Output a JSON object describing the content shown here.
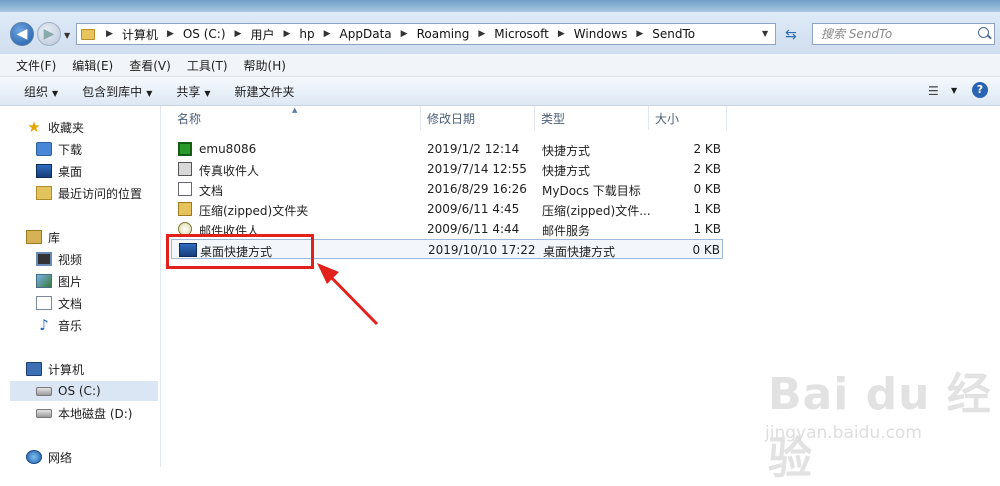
{
  "address": {
    "crumbs": [
      "计算机",
      "OS (C:)",
      "用户",
      "hp",
      "AppData",
      "Roaming",
      "Microsoft",
      "Windows",
      "SendTo"
    ],
    "search_placeholder": "搜索 SendTo"
  },
  "menu": [
    "文件(F)",
    "编辑(E)",
    "查看(V)",
    "工具(T)",
    "帮助(H)"
  ],
  "toolbar": {
    "organize": "组织",
    "include_library": "包含到库中",
    "share": "共享",
    "new_folder": "新建文件夹"
  },
  "sidebar": {
    "favorites": "收藏夹",
    "downloads": "下载",
    "desktop": "桌面",
    "recent": "最近访问的位置",
    "library": "库",
    "videos": "视频",
    "pictures": "图片",
    "documents": "文档",
    "music": "音乐",
    "computer": "计算机",
    "drive_c": "OS (C:)",
    "drive_d": "本地磁盘 (D:)",
    "network": "网络"
  },
  "columns": {
    "name": "名称",
    "date": "修改日期",
    "type": "类型",
    "size": "大小"
  },
  "files": [
    {
      "name": "emu8086",
      "date": "2019/1/2 12:14",
      "type": "快捷方式",
      "size": "2 KB",
      "icon": "chip-icon"
    },
    {
      "name": "传真收件人",
      "date": "2019/7/14 12:55",
      "type": "快捷方式",
      "size": "2 KB",
      "icon": "fax-icon"
    },
    {
      "name": "文档",
      "date": "2016/8/29 16:26",
      "type": "MyDocs 下载目标",
      "size": "0 KB",
      "icon": "document-icon"
    },
    {
      "name": "压缩(zipped)文件夹",
      "date": "2009/6/11 4:45",
      "type": "压缩(zipped)文件...",
      "size": "1 KB",
      "icon": "zip-folder-icon"
    },
    {
      "name": "邮件收件人",
      "date": "2009/6/11 4:44",
      "type": "邮件服务",
      "size": "1 KB",
      "icon": "mail-icon"
    },
    {
      "name": "桌面快捷方式",
      "date": "2019/10/10 17:22",
      "type": "桌面快捷方式",
      "size": "0 KB",
      "icon": "desktop-shortcut-icon"
    }
  ],
  "watermark": {
    "main": "Bai du 经验",
    "sub": "jingyan.baidu.com"
  },
  "colors": {
    "highlight_box": "#e3211c",
    "selected_row_border": "#9fb8d8"
  }
}
